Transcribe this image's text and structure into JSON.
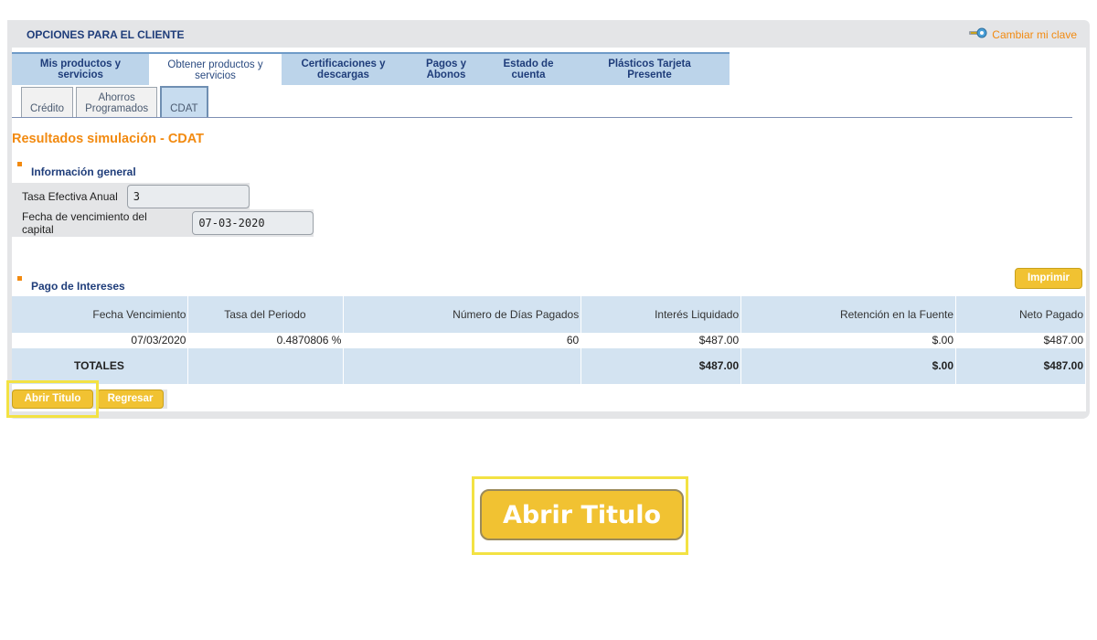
{
  "header": {
    "client_options_tab": "OPCIONES PARA EL CLIENTE",
    "change_password": "Cambiar mi clave"
  },
  "main_tabs": [
    {
      "l1": "Mis productos y",
      "l2": "servicios"
    },
    {
      "l1": "Obtener productos y",
      "l2": "servicios"
    },
    {
      "l1": "Certificaciones y",
      "l2": "descargas"
    },
    {
      "l1": "Pagos y",
      "l2": "Abonos"
    },
    {
      "l1": "Estado de",
      "l2": "cuenta"
    },
    {
      "l1": "Plásticos Tarjeta",
      "l2": "Presente"
    }
  ],
  "sub_tabs": [
    {
      "l1": "",
      "l2": "Crédito"
    },
    {
      "l1": "Ahorros",
      "l2": "Programados"
    },
    {
      "l1": "",
      "l2": "CDAT"
    }
  ],
  "result_title": "Resultados simulación - CDAT",
  "general_info": {
    "title": "Información general",
    "rate_label": "Tasa Efectiva Anual",
    "rate_value": "3",
    "maturity_label": "Fecha de vencimiento del capital",
    "maturity_value": "07-03-2020"
  },
  "interest": {
    "title": "Pago de Intereses",
    "print_label": "Imprimir",
    "columns": [
      "Fecha Vencimiento",
      "Tasa del Periodo",
      "Número de Días Pagados",
      "Interés Liquidado",
      "Retención en la Fuente",
      "Neto Pagado"
    ],
    "rows": [
      [
        "07/03/2020",
        "0.4870806 %",
        "60",
        "$487.00",
        "$.00",
        "$487.00"
      ]
    ],
    "totals_label": "TOTALES",
    "totals": [
      "$487.00",
      "$.00",
      "$487.00"
    ]
  },
  "actions": {
    "open_title": "Abrir Titulo",
    "back": "Regresar"
  },
  "zoom": {
    "label": "Abrir Titulo"
  },
  "colors": {
    "accent_orange": "#f28a10",
    "button_yellow": "#f1c232",
    "highlight": "#f3e243",
    "header_blue": "#1f3d7a"
  }
}
